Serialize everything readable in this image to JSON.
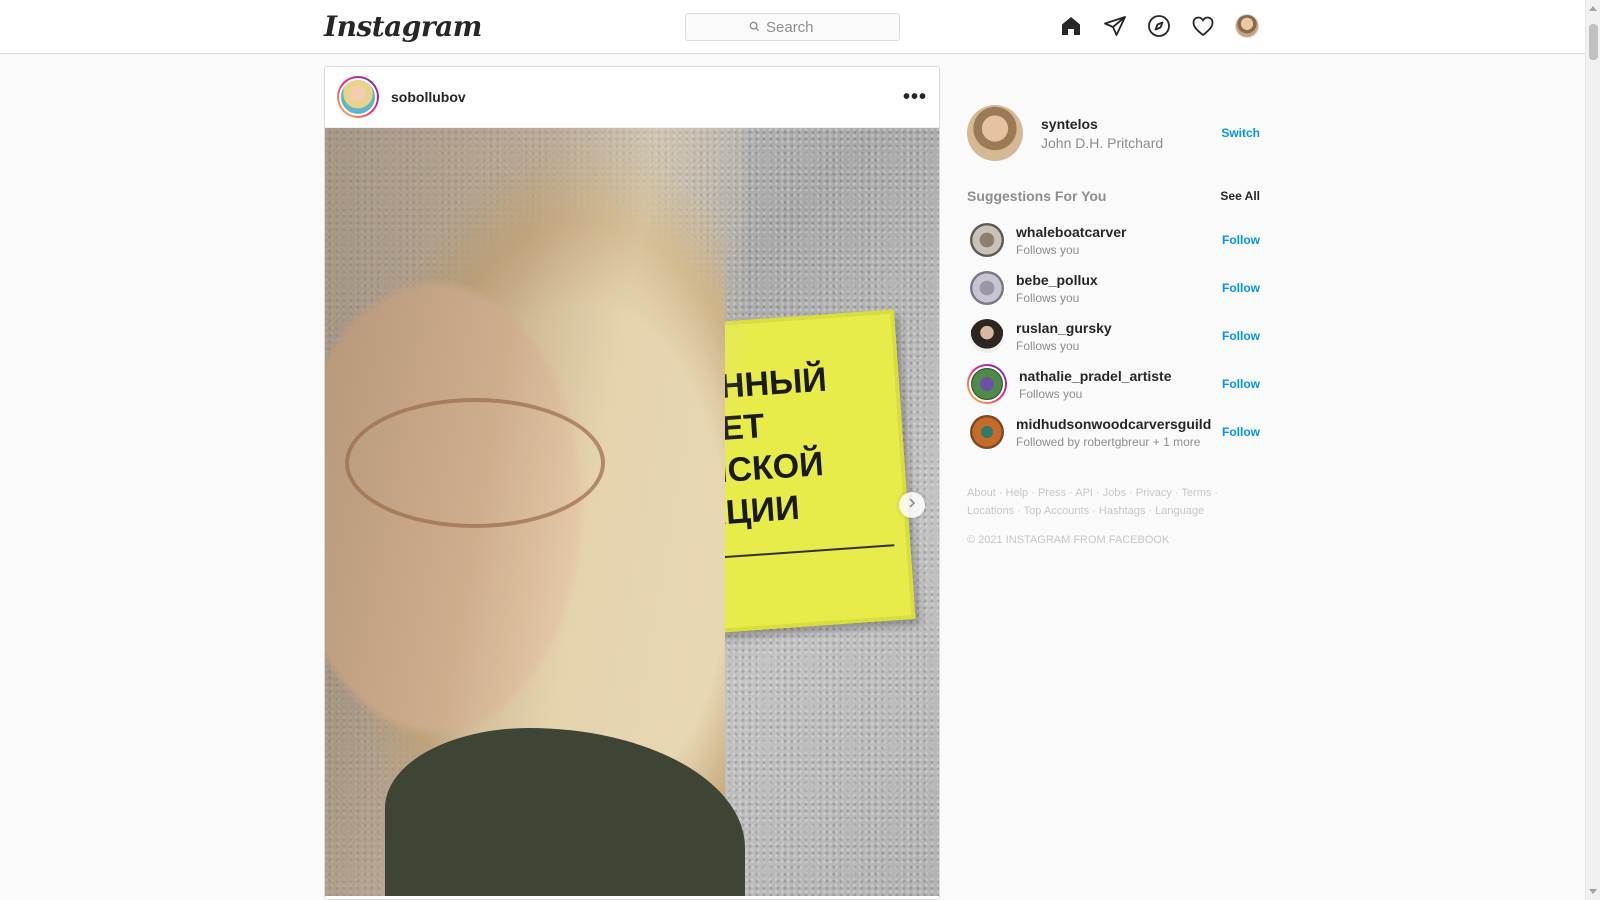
{
  "brand": {
    "logo_text": "Instagram"
  },
  "search": {
    "placeholder": "Search"
  },
  "nav": {
    "icons": [
      "home-icon",
      "direct-icon",
      "explore-icon",
      "activity-heart-icon",
      "profile-avatar"
    ]
  },
  "post": {
    "username": "sobollubov",
    "more_label": "•••",
    "sign_text": "ВЕННЫЙ\nИТЕТ\nИЙСКОЙ\nРАЦИИ"
  },
  "me": {
    "username": "syntelos",
    "fullname": "John D.H. Pritchard",
    "switch_label": "Switch"
  },
  "suggestions": {
    "title": "Suggestions For You",
    "see_all": "See All",
    "follow_label": "Follow",
    "items": [
      {
        "name": "whaleboatcarver",
        "sub": "Follows you"
      },
      {
        "name": "bebe_pollux",
        "sub": "Follows you"
      },
      {
        "name": "ruslan_gursky",
        "sub": "Follows you"
      },
      {
        "name": "nathalie_pradel_artiste",
        "sub": "Follows you"
      },
      {
        "name": "midhudsonwoodcarversguild",
        "sub": "Followed by robertgbreur + 1 more"
      }
    ]
  },
  "footer": {
    "links": [
      "About",
      "Help",
      "Press",
      "API",
      "Jobs",
      "Privacy",
      "Terms",
      "Locations",
      "Top Accounts",
      "Hashtags",
      "Language"
    ],
    "copyright": "© 2021 Instagram from Facebook"
  },
  "colors": {
    "accent": "#0095f6",
    "border": "#dbdbdb",
    "muted": "#8e8e8e"
  }
}
